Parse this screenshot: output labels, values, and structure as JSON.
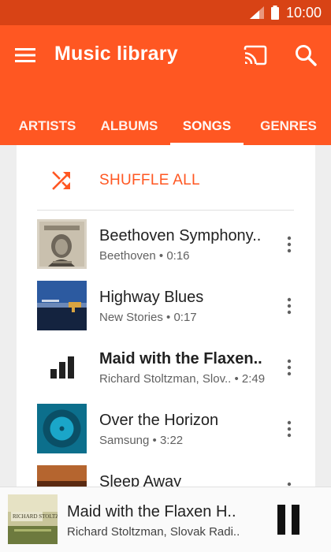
{
  "status": {
    "time": "10:00"
  },
  "header": {
    "title": "Music library"
  },
  "tabs": [
    {
      "label": "ARTISTS",
      "active": false
    },
    {
      "label": "ALBUMS",
      "active": false
    },
    {
      "label": "SONGS",
      "active": true
    },
    {
      "label": "GENRES",
      "active": false
    }
  ],
  "shuffle": {
    "label": "SHUFFLE ALL"
  },
  "songs": [
    {
      "title": "Beethoven Symphony..",
      "subtitle": "Beethoven • 0:16",
      "art": "beethoven-portrait"
    },
    {
      "title": "Highway Blues",
      "subtitle": "New Stories • 0:17",
      "art": "highway-blues-cover"
    },
    {
      "title": "Maid with the Flaxen..",
      "subtitle": "Richard Stoltzman, Slov..  • 2:49",
      "art": "now-playing-equalizer-icon",
      "playing": true
    },
    {
      "title": "Over the Horizon",
      "subtitle": "Samsung • 3:22",
      "art": "over-the-horizon-cover"
    },
    {
      "title": "Sleep Away",
      "subtitle": "",
      "art": "sleep-away-cover"
    }
  ],
  "now_playing": {
    "title": "Maid with the Flaxen H..",
    "subtitle": "Richard Stoltzman, Slovak Radi..",
    "art_lettering": "RICHARD STOLTZMAN"
  },
  "colors": {
    "primary": "#ff5722",
    "status_bar": "#d84315"
  }
}
